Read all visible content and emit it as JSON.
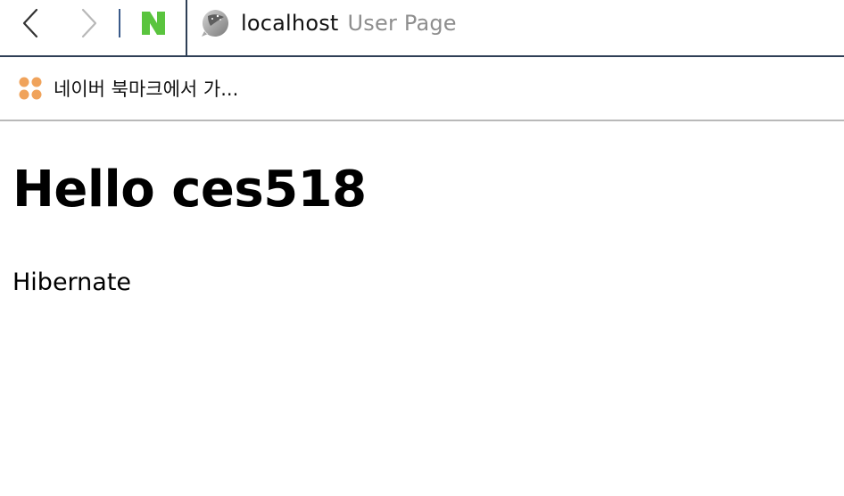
{
  "toolbar": {
    "back_icon": "chevron-left-icon",
    "forward_icon": "chevron-right-icon",
    "naver_icon": "naver-n-icon",
    "naver_letter": "N",
    "naver_color": "#5ac43e",
    "address": {
      "host": "localhost",
      "title": "User Page",
      "site_icon": "site-globe-icon"
    }
  },
  "bookmarks_bar": {
    "items": [
      {
        "label": "네이버 북마크에서 가...",
        "icon": "four-dots-icon",
        "icon_color": "#f0a35b"
      }
    ]
  },
  "page": {
    "heading": "Hello ces518",
    "body_text": "Hibernate"
  }
}
